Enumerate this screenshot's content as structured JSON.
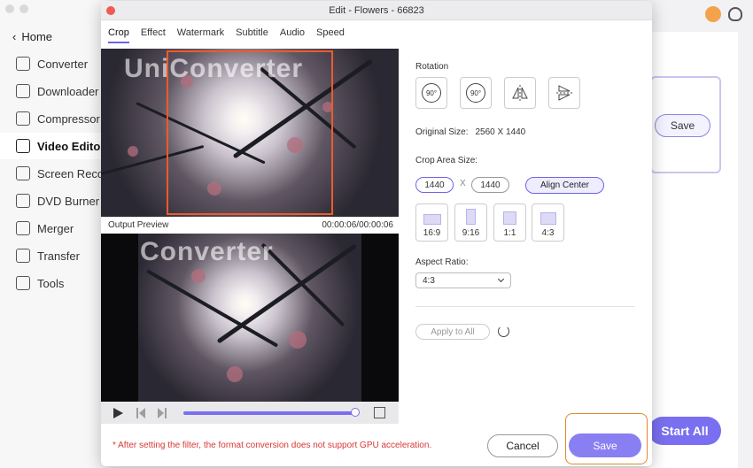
{
  "sidebar": {
    "home_label": "Home",
    "items": [
      {
        "label": "Converter",
        "icon": "converter-icon"
      },
      {
        "label": "Downloader",
        "icon": "downloader-icon"
      },
      {
        "label": "Compressor",
        "icon": "compressor-icon"
      },
      {
        "label": "Video Editor",
        "icon": "video-editor-icon",
        "active": true
      },
      {
        "label": "Screen Reco",
        "icon": "screen-recorder-icon"
      },
      {
        "label": "DVD Burner",
        "icon": "dvd-burner-icon"
      },
      {
        "label": "Merger",
        "icon": "merger-icon"
      },
      {
        "label": "Transfer",
        "icon": "transfer-icon"
      },
      {
        "label": "Tools",
        "icon": "tools-icon"
      }
    ]
  },
  "background": {
    "save_label": "Save",
    "start_all_label": "Start All"
  },
  "dialog": {
    "title": "Edit - Flowers - 66823",
    "tabs": [
      "Crop",
      "Effect",
      "Watermark",
      "Subtitle",
      "Audio",
      "Speed"
    ],
    "active_tab": "Crop",
    "watermark_text_top": "UniConverter",
    "watermark_text_bottom": "Converter",
    "output_preview_label": "Output Preview",
    "time_readout": "00:00:06/00:00:06",
    "playback_progress": 1.0,
    "rotation_label": "Rotation",
    "rotation_buttons": [
      {
        "label": "90°",
        "icon": "rotate-left-icon"
      },
      {
        "label": "90°",
        "icon": "rotate-right-icon"
      },
      {
        "label": "",
        "icon": "flip-horizontal-icon"
      },
      {
        "label": "",
        "icon": "flip-vertical-icon"
      }
    ],
    "original_size_label": "Original Size:",
    "original_size_value": "2560 X 1440",
    "crop_area_label": "Crop Area Size:",
    "crop_width": "1440",
    "crop_separator": "X",
    "crop_height": "1440",
    "align_center_label": "Align Center",
    "ratio_options": [
      "16:9",
      "9:16",
      "1:1",
      "4:3"
    ],
    "aspect_ratio_label": "Aspect Ratio:",
    "aspect_ratio_value": "4:3",
    "apply_all_label": "Apply to All",
    "notice": "* After setting the filter, the format conversion does not support GPU acceleration.",
    "cancel_label": "Cancel",
    "save_label": "Save"
  },
  "colors": {
    "accent": "#7a6ff0",
    "crop_border": "#f05a28",
    "highlight": "#e08a2a",
    "notice": "#d63a34"
  }
}
